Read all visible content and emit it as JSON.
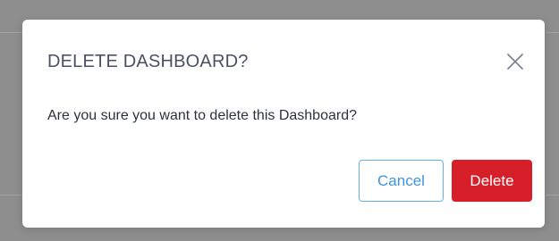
{
  "dialog": {
    "title": "DELETE DASHBOARD?",
    "message": "Are you sure you want to delete this Dashboard?",
    "cancel_label": "Cancel",
    "delete_label": "Delete",
    "close_icon": "close-icon"
  },
  "colors": {
    "title": "#4a5262",
    "text": "#2d323c",
    "cancel_border": "#66b0e8",
    "cancel_text": "#3f95da",
    "delete_bg": "#d71f2a",
    "backdrop": "#8e8e8e"
  }
}
